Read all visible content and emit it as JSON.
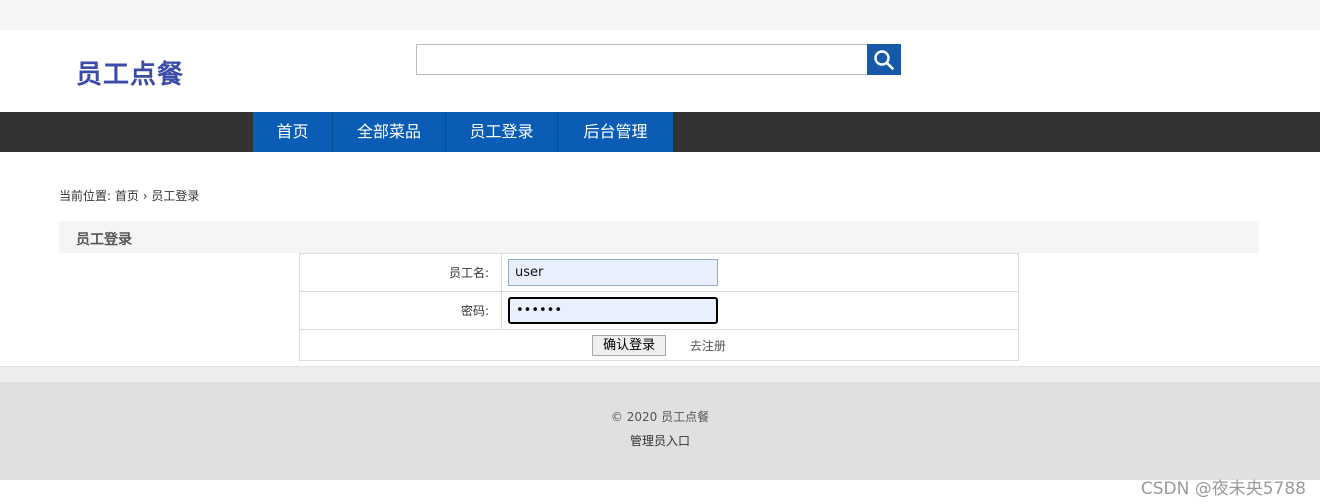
{
  "site": {
    "logo": "员工点餐"
  },
  "search": {
    "placeholder": "",
    "icon": "search-icon"
  },
  "nav": {
    "items": [
      "首页",
      "全部菜品",
      "员工登录",
      "后台管理"
    ]
  },
  "breadcrumb": {
    "prefix": "当前位置:",
    "home": "首页",
    "separator": "›",
    "current": "员工登录"
  },
  "login": {
    "title": "员工登录",
    "username_label": "员工名:",
    "username_value": "user",
    "password_label": "密码:",
    "password_value": "••••••",
    "submit_label": "确认登录",
    "register_label": "去注册"
  },
  "footer": {
    "copyright": "© 2020 员工点餐",
    "admin_link": "管理员入口"
  },
  "watermark": "CSDN @夜未央5788",
  "colors": {
    "brand": "#3a4ba8",
    "nav_bg": "#333333",
    "nav_active": "#0a5cb5",
    "search_button": "#1659a8"
  }
}
